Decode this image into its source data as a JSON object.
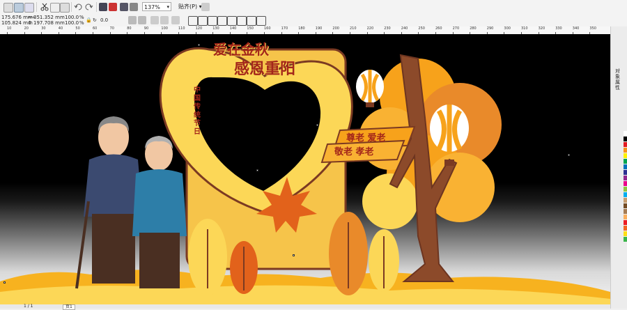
{
  "toolbar": {
    "zoom_value": "137%",
    "paste_menu_label": "贴齐(P)"
  },
  "property_bar": {
    "x_value": "175.676 mm",
    "y_value": "105.824 mm",
    "width_value": "351.352 mm",
    "height_value": "197.708 mm",
    "scale_x": "100.0",
    "scale_y": "100.0",
    "percent_x": "%",
    "percent_y": "%",
    "rotation_value": "0.0"
  },
  "ruler": {
    "ticks": [
      "10",
      "20",
      "30",
      "40",
      "50",
      "60",
      "70",
      "80",
      "90",
      "100",
      "110",
      "120",
      "130",
      "140",
      "150",
      "160",
      "170",
      "180",
      "190",
      "200",
      "210",
      "220",
      "230",
      "240",
      "250",
      "260",
      "270",
      "280",
      "290",
      "300",
      "310",
      "320",
      "330",
      "340",
      "350"
    ]
  },
  "artwork": {
    "title_line1": "爱在金秋",
    "title_line2": "感恩重阳",
    "vertical_text": "中国传统节日",
    "banner1": "尊老 爱老",
    "banner2": "敬老 孝老",
    "colors": {
      "orange": "#f7a21b",
      "deep_orange": "#e2621b",
      "yellow": "#fcd757",
      "brown": "#7b3a22",
      "title_red": "#a3261a",
      "background": "#000000"
    }
  },
  "side_panel": {
    "tab_label": "对象属性"
  },
  "status": {
    "page_counter": "1 / 1",
    "page_tab": "页1"
  },
  "palette": [
    "#ffffff",
    "#000000",
    "#e21b23",
    "#f7931e",
    "#fff200",
    "#00a651",
    "#0072bc",
    "#2e3192",
    "#92278f",
    "#ec008c",
    "#8dc63f",
    "#00aeef",
    "#c69c6d",
    "#754c24",
    "#a67c52",
    "#fbaf5d",
    "#ed1c24",
    "#f26522",
    "#ffde17",
    "#39b54a"
  ]
}
